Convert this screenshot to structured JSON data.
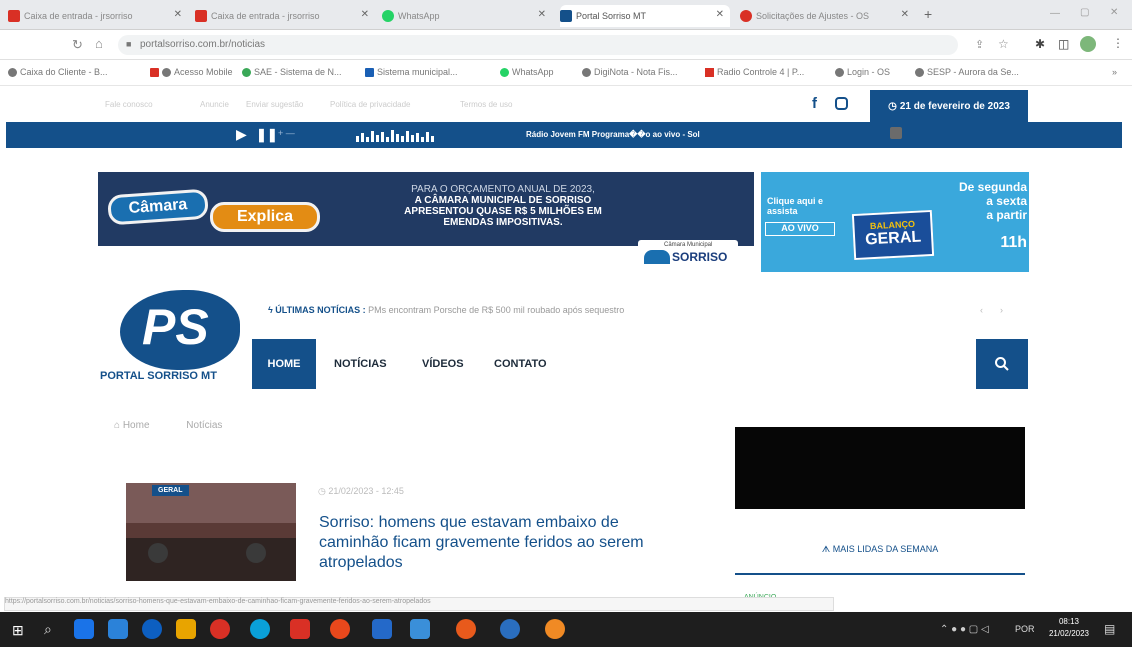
{
  "browser": {
    "tabs": [
      {
        "label": "Caixa de entrada - jrsorriso",
        "favicon_color": "#d93025"
      },
      {
        "label": "Caixa de entrada - jrsorriso",
        "favicon_color": "#d93025"
      },
      {
        "label": "WhatsApp",
        "favicon_color": "#25d366"
      },
      {
        "label": "Portal Sorriso MT",
        "favicon_color": "#14508a"
      },
      {
        "label": "Solicitações de Ajustes - OS",
        "favicon_color": "#d93025"
      }
    ],
    "url": "portalsorriso.com.br/noticias",
    "bookmarks": [
      "Caixa do Cliente - B...",
      "Acesso Mobile",
      "SAE - Sistema de N...",
      "Sistema municipal...",
      "WhatsApp",
      "DigiNota - Nota Fis...",
      "Radio Controle 4 | P...",
      "Login - OS",
      "SESP - Aurora da Se..."
    ]
  },
  "site": {
    "topnav_links": [
      "Fale conosco",
      "Anuncie",
      "Enviar sugestão",
      "Política de privacidade",
      "Termos de uso"
    ],
    "date": "21 de fevereiro de 2023",
    "radio_text": "Rádio Jovem FM   Programa��o ao vivo - Sol",
    "banner1": {
      "badge": "Câmara",
      "badge2": "Explica",
      "line1": "PARA O ORÇAMENTO ANUAL DE 2023,",
      "line2": "A CÂMARA MUNICIPAL DE SORRISO",
      "line3": "APRESENTOU QUASE R$ 5 MILHÕES EM",
      "line4": "EMENDAS IMPOSITIVAS.",
      "logo": "SORRISO",
      "logo_top": "Câmara Municipal"
    },
    "banner2": {
      "click": "Clique aqui e assista",
      "live": "AO VIVO",
      "show1": "BALANÇO",
      "show2": "GERAL",
      "sched1": "De segunda",
      "sched2": "a sexta",
      "sched3": "a partir",
      "sched4": "11h"
    },
    "logo": {
      "letters": "PS",
      "name": "PORTAL SORRISO MT"
    },
    "ticker": {
      "label": "ÚLTIMAS NOTÍCIAS :",
      "text": "PMs encontram Porsche de R$ 500 mil roubado após sequestro"
    },
    "menu": [
      "HOME",
      "NOTÍCIAS",
      "VÍDEOS",
      "CONTATO"
    ],
    "breadcrumb": [
      "Home",
      "Notícias"
    ],
    "article": {
      "category": "GERAL",
      "date": "21/02/2023 - 12:45",
      "title": "Sorriso: homens que estavam embaixo de caminhão ficam gravemente feridos ao serem atropelados"
    },
    "sidebar": {
      "section": "MAIS LIDAS DA SEMANA",
      "ad_label": "ANÚNCIO"
    }
  },
  "status_url": "https://portalsorriso.com.br/noticias/sorriso-homens-que-estavam-embaixo-de-caminhao-ficam-gravemente-feridos-ao-serem-atropelados",
  "taskbar": {
    "time": "08:13",
    "date": "21/02/2023",
    "lang": "POR",
    "icon_colors": [
      "#1a73e8",
      "#2b82d9",
      "#0d5fc1",
      "#e8a400",
      "#d93025",
      "#0aa0d8",
      "#d93025",
      "#e8481c",
      "#2469c9",
      "#3a8fd9",
      "#e85a1c",
      "#2a6ebf",
      "#f08a24"
    ]
  }
}
